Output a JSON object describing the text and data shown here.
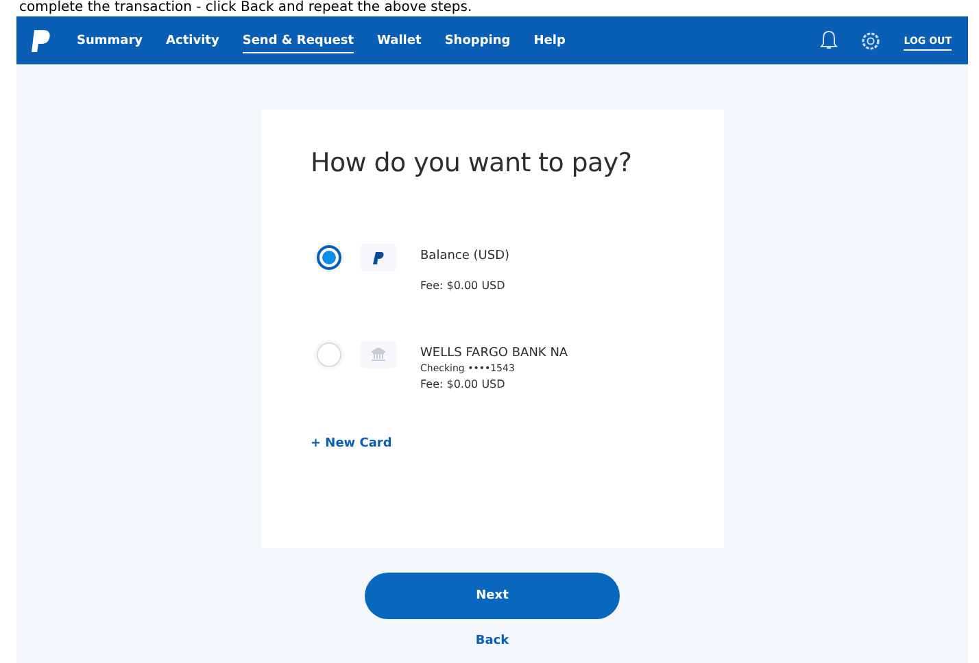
{
  "caption": "complete the transaction - click Back and repeat the above steps.",
  "nav": {
    "items": [
      {
        "label": "Summary",
        "selected": false
      },
      {
        "label": "Activity",
        "selected": false
      },
      {
        "label": "Send & Request",
        "selected": true
      },
      {
        "label": "Wallet",
        "selected": false
      },
      {
        "label": "Shopping",
        "selected": false
      },
      {
        "label": "Help",
        "selected": false
      }
    ],
    "logout": "LOG OUT"
  },
  "title": "How do you want to pay?",
  "options": [
    {
      "kind": "balance",
      "name": "Balance (USD)",
      "fee": "Fee: $0.00 USD",
      "selected": true
    },
    {
      "kind": "bank",
      "name": "WELLS FARGO BANK NA",
      "detail": "Checking ••••1543",
      "fee": "Fee: $0.00 USD",
      "selected": false
    }
  ],
  "new_card": "+ New Card",
  "next": "Next",
  "back": "Back"
}
